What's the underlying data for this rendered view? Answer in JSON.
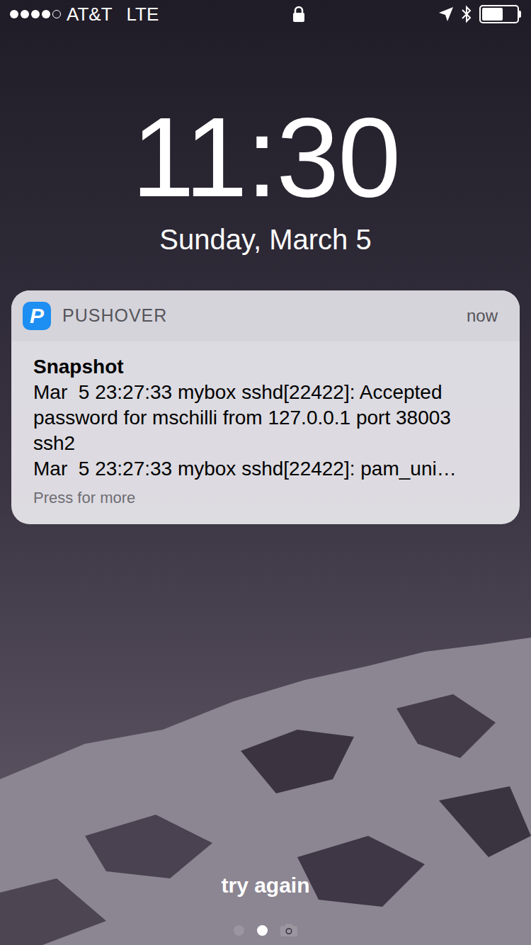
{
  "status_bar": {
    "signal": [
      {
        "on": true
      },
      {
        "on": true
      },
      {
        "on": true
      },
      {
        "on": true
      },
      {
        "on": false
      }
    ],
    "carrier": "AT&T",
    "network": "LTE",
    "battery": {
      "level": 0.6
    }
  },
  "clock": {
    "time": "11:30",
    "date": "Sunday, March 5"
  },
  "notification": {
    "app_icon": "P",
    "app": "PUSHOVER",
    "time": "now",
    "title": "Snapshot",
    "messages": [
      "Mar  5 23:27:33 mybox sshd[22422]: Accepted password for mschilli from 127.0.0.1 port 38003 ssh2",
      "Mar  5 23:27:33 mybox sshd[22422]: pam_uni…"
    ],
    "hint": "Press for more"
  },
  "prompt": "try again",
  "page_dots": [
    {
      "kind": "dot",
      "selected": false
    },
    {
      "kind": "dot",
      "selected": true
    },
    {
      "kind": "camera",
      "selected": false
    }
  ]
}
